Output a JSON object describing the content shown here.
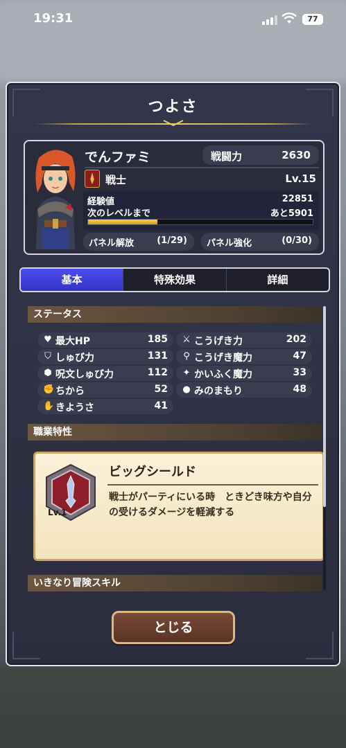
{
  "status_bar": {
    "time": "19:31",
    "battery": "77"
  },
  "window": {
    "title": "つよさ"
  },
  "character": {
    "name": "でんファミ",
    "power_label": "戦闘力",
    "power_value": "2630",
    "job": "戦士",
    "level": "Lv.15",
    "exp_label": "経験値",
    "exp_value": "22851",
    "next_label": "次のレベルまで",
    "next_value": "あと5901",
    "exp_progress": 0.31,
    "panel_unlock_label": "パネル解放",
    "panel_unlock_value": "(1/29)",
    "panel_boost_label": "パネル強化",
    "panel_boost_value": "(0/30)"
  },
  "tabs": [
    {
      "label": "基本",
      "active": true
    },
    {
      "label": "特殊効果",
      "active": false
    },
    {
      "label": "詳細",
      "active": false
    }
  ],
  "status_section": {
    "title": "ステータス",
    "stats": [
      {
        "icon": "heart-icon",
        "label": "最大HP",
        "value": "185"
      },
      {
        "icon": "sword-icon",
        "label": "こうげき力",
        "value": "202"
      },
      {
        "icon": "shield-icon",
        "label": "しゅび力",
        "value": "131"
      },
      {
        "icon": "magic-wand-icon",
        "label": "こうげき魔力",
        "value": "47"
      },
      {
        "icon": "magic-shield-icon",
        "label": "呪文しゅび力",
        "value": "112"
      },
      {
        "icon": "sparkle-icon",
        "label": "かいふく魔力",
        "value": "33"
      },
      {
        "icon": "fist-icon",
        "label": "ちから",
        "value": "52"
      },
      {
        "icon": "droplet-icon",
        "label": "みのまもり",
        "value": "48"
      },
      {
        "icon": "hand-icon",
        "label": "きようさ",
        "value": "41"
      }
    ]
  },
  "job_trait_section": {
    "title": "職業特性",
    "trait_name": "ビッグシールド",
    "trait_desc": "戦士がパーティにいる時　ときどき味方や自分の受けるダメージを軽減する",
    "trait_level": "Lv.1"
  },
  "adventure_skill_section": {
    "title": "いきなり冒険スキル"
  },
  "close_label": "とじる"
}
